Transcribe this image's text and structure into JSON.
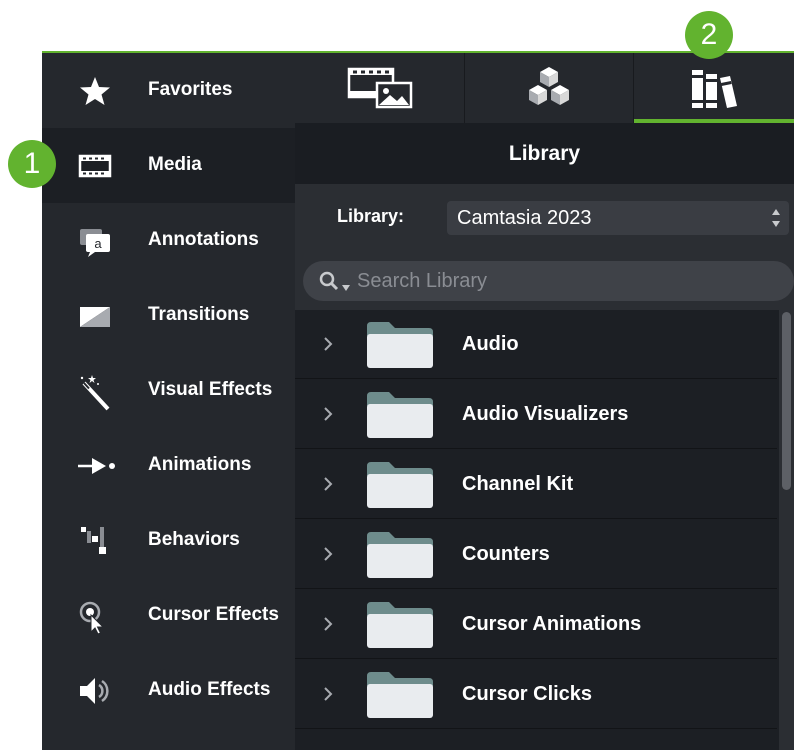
{
  "callouts": {
    "one": "1",
    "two": "2"
  },
  "sidebar": {
    "items": [
      {
        "label": "Favorites",
        "icon": "star-icon"
      },
      {
        "label": "Media",
        "icon": "film-strip-icon"
      },
      {
        "label": "Annotations",
        "icon": "annotation-icon"
      },
      {
        "label": "Transitions",
        "icon": "transition-icon"
      },
      {
        "label": "Visual Effects",
        "icon": "magic-wand-icon"
      },
      {
        "label": "Animations",
        "icon": "animation-arrow-icon"
      },
      {
        "label": "Behaviors",
        "icon": "behaviors-icon"
      },
      {
        "label": "Cursor Effects",
        "icon": "cursor-effects-icon"
      },
      {
        "label": "Audio Effects",
        "icon": "speaker-icon"
      }
    ]
  },
  "tabs": [
    {
      "name": "media-bin",
      "icon": "media-bin-icon"
    },
    {
      "name": "quiz",
      "icon": "cubes-icon"
    },
    {
      "name": "library",
      "icon": "library-books-icon",
      "active": true
    }
  ],
  "library": {
    "title": "Library",
    "label": "Library:",
    "selected": "Camtasia 2023",
    "search_placeholder": "Search Library",
    "items": [
      {
        "label": "Audio"
      },
      {
        "label": "Audio Visualizers"
      },
      {
        "label": "Channel Kit"
      },
      {
        "label": "Counters"
      },
      {
        "label": "Cursor Animations"
      },
      {
        "label": "Cursor Clicks"
      }
    ]
  },
  "colors": {
    "accent": "#62b32f",
    "panel": "#25282d",
    "background": "#1a1d22",
    "text": "#ffffff"
  }
}
